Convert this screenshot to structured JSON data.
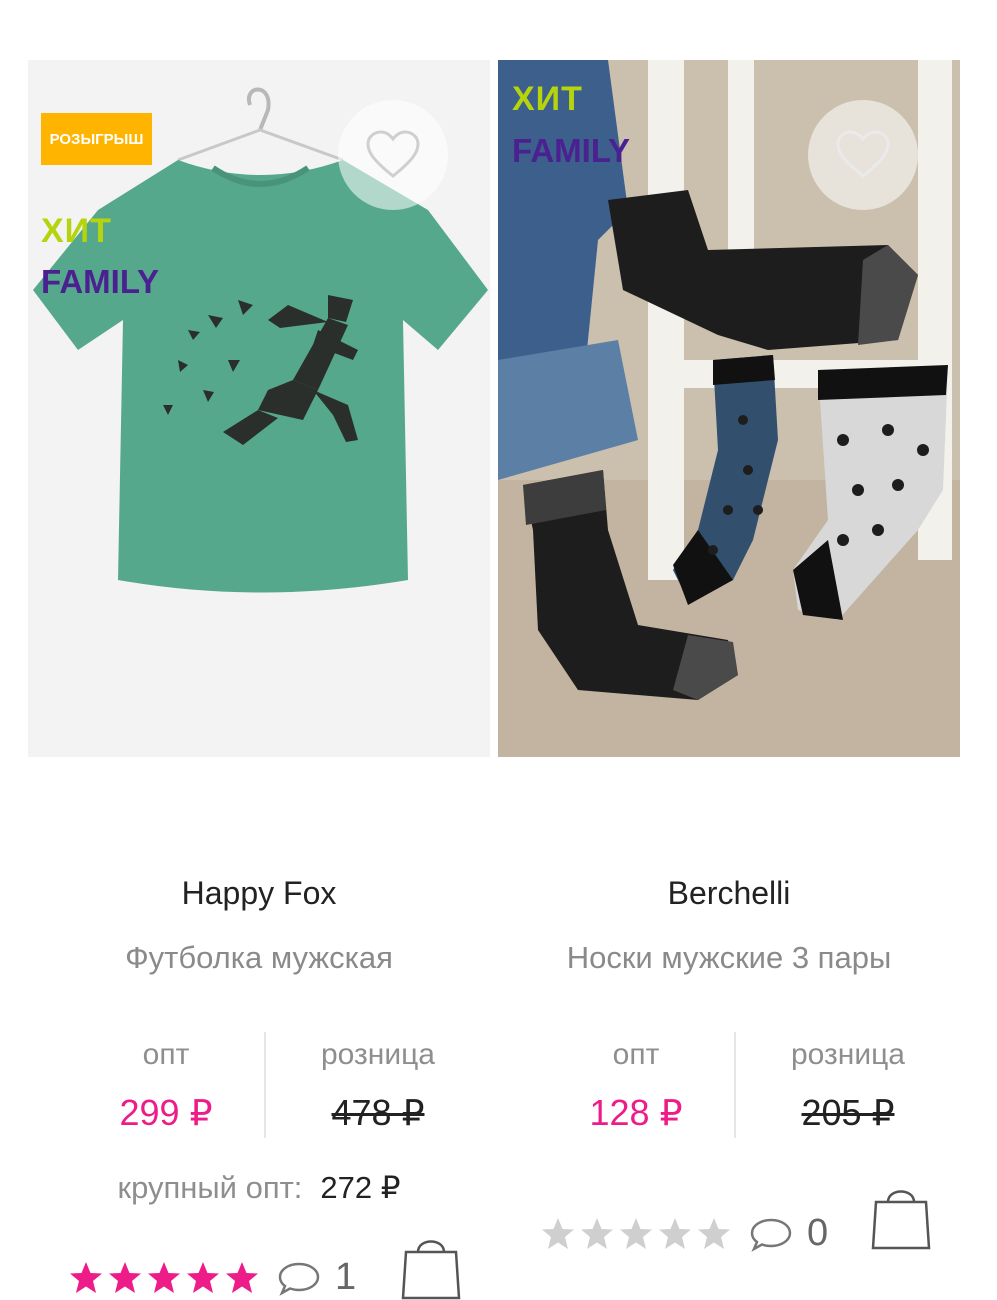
{
  "products": [
    {
      "badge": "РОЗЫГРЫШ",
      "label_hit": "ХИТ",
      "label_family": "FAMILY",
      "brand": "Happy Fox",
      "name": "Футболка мужская",
      "opt_label": "опт",
      "opt_price": "299 ₽",
      "retail_label": "розница",
      "retail_price": "478 ₽",
      "bulk_label": "крупный опт:",
      "bulk_price": "272 ₽",
      "rating": 5,
      "comments": "1",
      "star_color": "#ee1c88"
    },
    {
      "label_hit": "ХИТ",
      "label_family": "FAMILY",
      "brand": "Berchelli",
      "name": "Носки мужские 3 пары",
      "opt_label": "опт",
      "opt_price": "128 ₽",
      "retail_label": "розница",
      "retail_price": "205 ₽",
      "rating": 0,
      "comments": "0",
      "star_color": "#cfcfcf"
    }
  ],
  "icons": {
    "favorite": "heart-outline-icon",
    "star": "star-icon",
    "comment": "speech-bubble-icon",
    "cart": "shopping-bag-icon"
  },
  "colors": {
    "price_accent": "#ee1c88",
    "badge_bg": "#ffb400",
    "hit_label": "#b5d40d",
    "family_label": "#4b2090"
  }
}
